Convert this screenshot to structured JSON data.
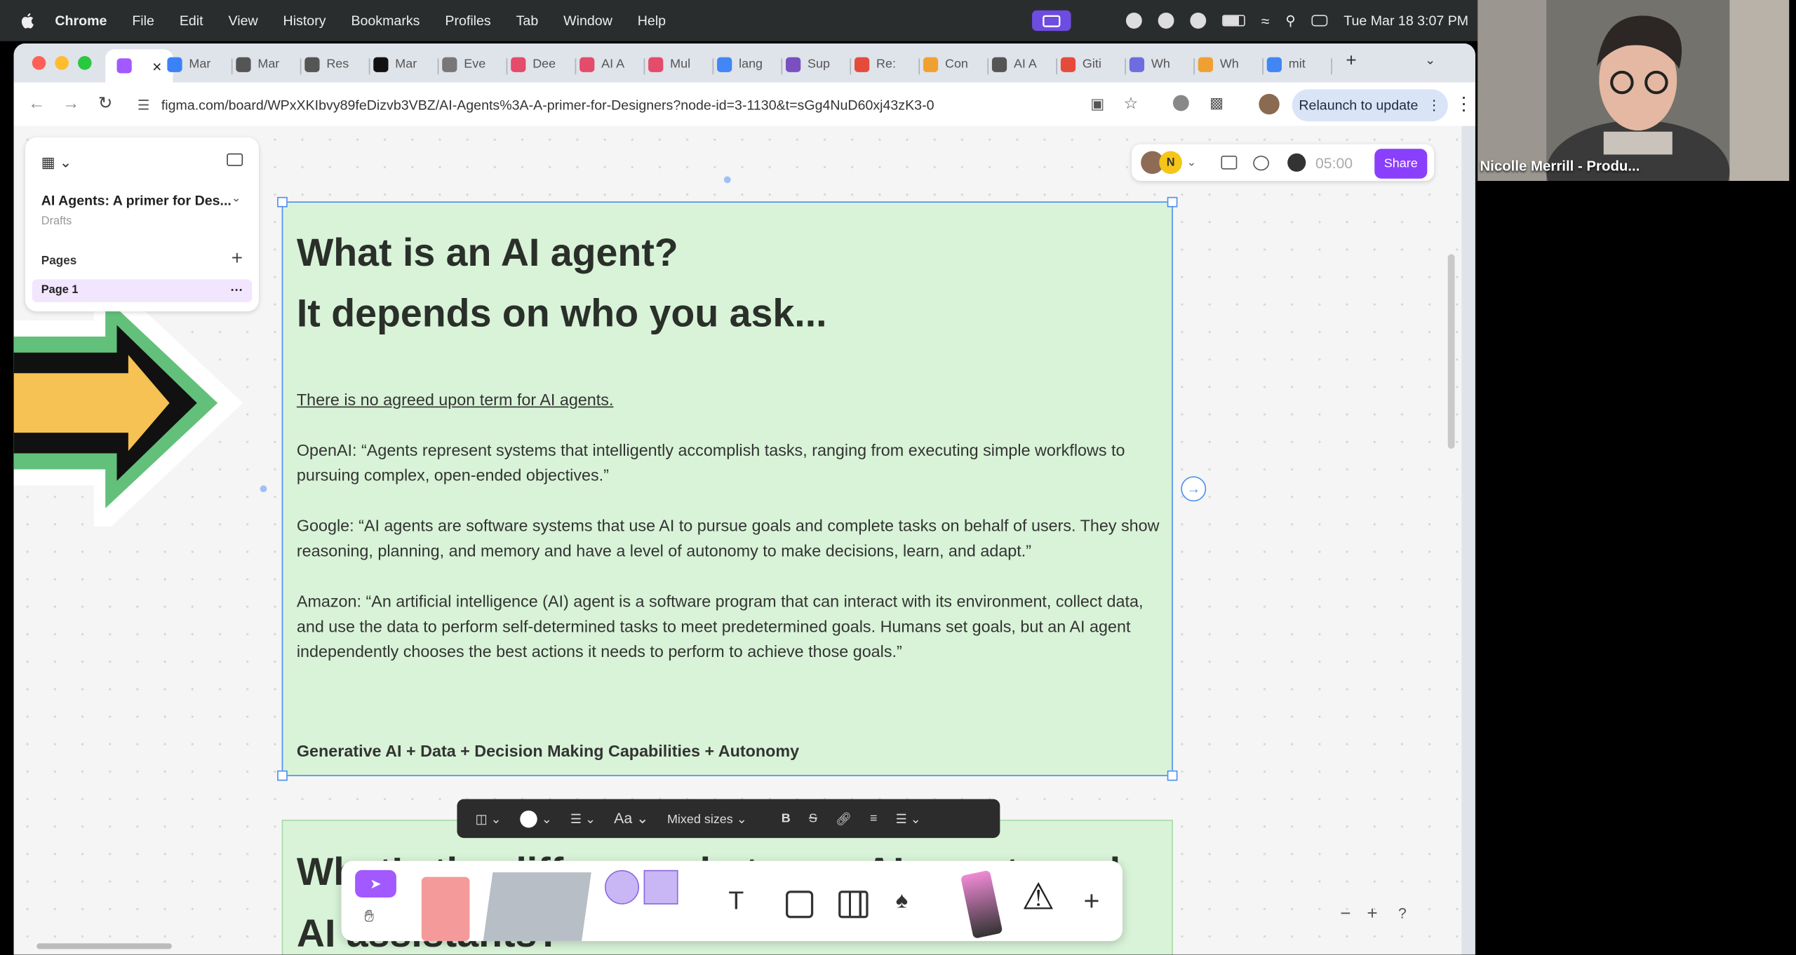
{
  "menubar": {
    "app": "Chrome",
    "items": [
      "File",
      "Edit",
      "View",
      "History",
      "Bookmarks",
      "Profiles",
      "Tab",
      "Window",
      "Help"
    ],
    "clock": "Tue Mar 18  3:07 PM"
  },
  "tabs": [
    {
      "label": "",
      "color": "#a259ff",
      "active": true
    },
    {
      "label": "Mar",
      "color": "#3b82f6"
    },
    {
      "label": "Mar",
      "color": "#555"
    },
    {
      "label": "Res",
      "color": "#555"
    },
    {
      "label": "Mar",
      "color": "#111"
    },
    {
      "label": "Eve",
      "color": "#777"
    },
    {
      "label": "Dee",
      "color": "#e54b6b"
    },
    {
      "label": "AI A",
      "color": "#e54b6b"
    },
    {
      "label": "Mul",
      "color": "#e54b6b"
    },
    {
      "label": "lang",
      "color": "#4285f4"
    },
    {
      "label": "Sup",
      "color": "#7a4fc0"
    },
    {
      "label": "Re:",
      "color": "#e54b3b"
    },
    {
      "label": "Con",
      "color": "#f0a030"
    },
    {
      "label": "AI A",
      "color": "#555"
    },
    {
      "label": "Giti",
      "color": "#e54b3b"
    },
    {
      "label": "Wh",
      "color": "#6d6de0"
    },
    {
      "label": "Wh",
      "color": "#f0a030"
    },
    {
      "label": "mit",
      "color": "#4285f4"
    }
  ],
  "url": "figma.com/board/WPxXKIbvy89feDizvb3VBZ/AI-Agents%3A-A-primer-for-Designers?node-id=3-1130&t=sGg4NuD60xj43zK3-0",
  "relaunch_label": "Relaunch to update",
  "sidebar": {
    "file_name": "AI Agents: A primer for Des...",
    "location": "Drafts",
    "pages_label": "Pages",
    "page_item": "Page 1"
  },
  "topright": {
    "avatar_initial": "N",
    "timer": "05:00",
    "share_label": "Share"
  },
  "card": {
    "title_line1": "What is an AI agent?",
    "title_line2": "It depends on who you ask...",
    "intro": "There is no agreed upon term for AI agents.",
    "openai": "OpenAI: “Agents represent systems that intelligently accomplish tasks, ranging from executing simple workflows to pursuing complex, open-ended objectives.”",
    "google": "Google: “AI agents are software systems that use AI to pursue goals and complete tasks on behalf of users. They show reasoning, planning, and memory and have a level of autonomy to make decisions, learn, and adapt.”",
    "amazon": "Amazon: “An artificial intelligence (AI) agent is a software program that can interact with its environment, collect data, and use the data to perform self-determined tasks to meet predetermined goals. Humans set goals, but an AI agent independently chooses the best actions it needs to perform to achieve those goals.”",
    "formula": "Generative AI + Data + Decision Making Capabilities + Autonomy"
  },
  "card2": {
    "title": "What’s the difference between AI agents and AI assistants?"
  },
  "format_toolbar": {
    "font_size": "Mixed sizes"
  },
  "webcam": {
    "name": "Nicolle Merrill - Produ..."
  },
  "colors": {
    "card_bg": "#d8f3d7",
    "selection": "#4b8ef0",
    "share": "#8a3ffc"
  }
}
